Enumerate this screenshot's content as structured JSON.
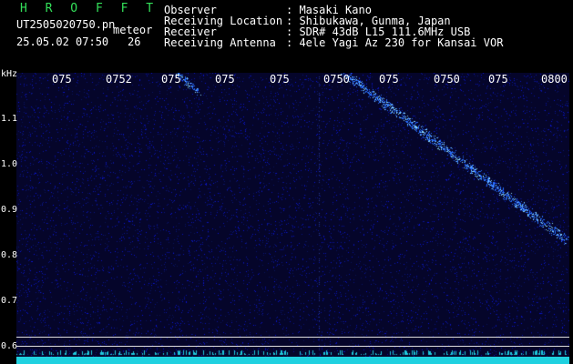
{
  "header": {
    "app_title": "H R O F F T",
    "filename": "UT2505020750.pn",
    "tag": "meteor",
    "datetime": "25.05.02 07:50",
    "count": "26"
  },
  "info": [
    {
      "label": "Observer",
      "value": ": Masaki Kano"
    },
    {
      "label": "Receiving Location",
      "value": ": Shibukawa, Gunma, Japan"
    },
    {
      "label": "Receiver",
      "value": ": SDR# 43dB L15 111.6MHz USB"
    },
    {
      "label": "Receiving Antenna",
      "value": ": 4ele Yagi Az 230 for Kansai VOR"
    }
  ],
  "axis": {
    "y_unit": "kHz",
    "x_ticks": [
      "075",
      "0752",
      "075",
      "075",
      "075",
      "0750",
      "075",
      "0750",
      "075",
      "0800"
    ],
    "y_ticks": [
      "1.1",
      "1.0",
      "0.9",
      "0.8",
      "0.7",
      "0.6"
    ]
  },
  "colors": {
    "background": "#05052a",
    "signal": "#1a6cff",
    "title": "#33e05a"
  }
}
